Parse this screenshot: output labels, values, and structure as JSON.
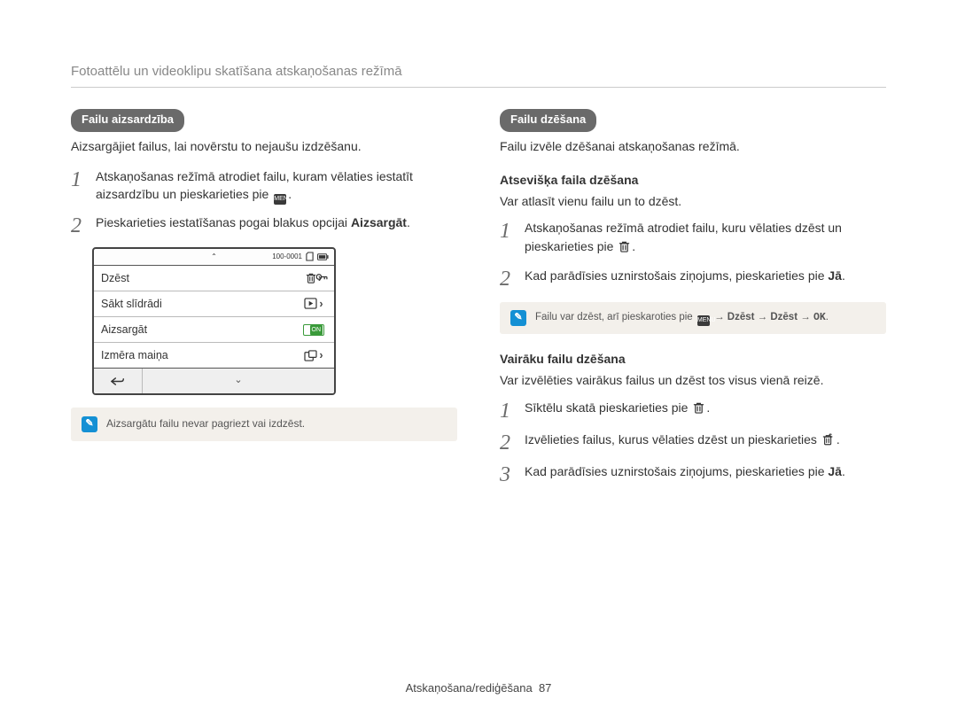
{
  "header": {
    "title": "Fotoattēlu un videoklipu skatīšana atskaņošanas režīmā"
  },
  "footer": {
    "section": "Atskaņošana/rediģēšana",
    "page": "87"
  },
  "left": {
    "pill": "Failu aizsardzība",
    "lead": "Aizsargājiet failus, lai novērstu to nejaušu izdzēšanu.",
    "step1a": "Atskaņošanas režīmā atrodiet failu, kuram vēlaties iestatīt aizsardzību un pieskarieties pie ",
    "step1b": ".",
    "step2a": "Pieskarieties iestatīšanas pogai blakus opcijai ",
    "step2b": "Aizsargāt",
    "step2c": ".",
    "menu": {
      "counter": "100-0001",
      "row1": "Dzēst",
      "row2": "Sākt slīdrādi",
      "row3": "Aizsargāt",
      "row4": "Izmēra maiņa"
    },
    "note": "Aizsargātu failu nevar pagriezt vai izdzēst."
  },
  "right": {
    "pill": "Failu dzēšana",
    "lead": "Failu izvēle dzēšanai atskaņošanas režīmā.",
    "sec1_head": "Atsevišķa faila dzēšana",
    "sec1_lead": "Var atlasīt vienu failu un to dzēst.",
    "sec1_step1a": "Atskaņošanas režīmā atrodiet failu, kuru vēlaties dzēst un pieskarieties pie ",
    "sec1_step1b": ".",
    "sec1_step2a": "Kad parādīsies uznirstošais ziņojums, pieskarieties pie ",
    "sec1_step2b": "Jā",
    "sec1_step2c": ".",
    "note1a": "Failu var dzēst, arī pieskaroties pie ",
    "note1b": " → ",
    "note1c": "Dzēst",
    "note1d": " → ",
    "note1e": "Dzēst",
    "note1f": " → ",
    "sec2_head": "Vairāku failu dzēšana",
    "sec2_lead": "Var izvēlēties vairākus failus un dzēst tos visus vienā reizē.",
    "sec2_step1a": "Sīktēlu skatā pieskarieties pie ",
    "sec2_step1b": ".",
    "sec2_step2a": "Izvēlieties failus, kurus vēlaties dzēst un pieskarieties ",
    "sec2_step2b": ".",
    "sec2_step3a": "Kad parādīsies uznirstošais ziņojums, pieskarieties pie ",
    "sec2_step3b": "Jā",
    "sec2_step3c": "."
  },
  "icons": {
    "menu": "MENU",
    "ok": "OK"
  }
}
